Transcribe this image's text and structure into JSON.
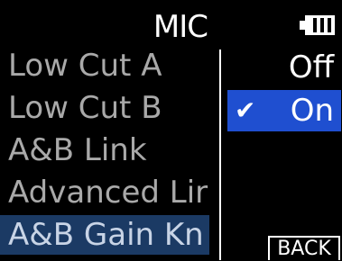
{
  "header": {
    "title": "MIC",
    "battery_icon": "battery-icon"
  },
  "menu": {
    "items": [
      {
        "label": "Low Cut A"
      },
      {
        "label": "Low Cut B"
      },
      {
        "label": "A&B Link"
      },
      {
        "label": "Advanced Lir"
      },
      {
        "label": "A&B Gain Kn"
      }
    ],
    "selected_index": 4
  },
  "options": {
    "items": [
      {
        "label": "Off"
      },
      {
        "label": "On",
        "check_icon": "check-icon"
      }
    ],
    "selected_index": 1
  },
  "footer": {
    "back_label": "BACK"
  },
  "colors": {
    "background": "#000000",
    "text": "#a9a9a9",
    "highlight_menu": "#1b3a64",
    "highlight_option": "#1f4fd0",
    "white": "#ffffff"
  }
}
